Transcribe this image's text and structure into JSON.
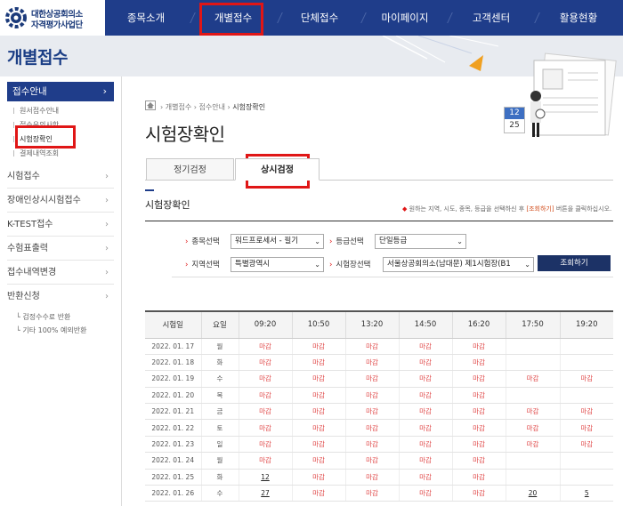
{
  "org": {
    "line1": "대한상공회의소",
    "line2": "자격평가사업단"
  },
  "nav": [
    {
      "label": "종목소개",
      "active": false
    },
    {
      "label": "개별접수",
      "active": true
    },
    {
      "label": "단체접수",
      "active": false
    },
    {
      "label": "마이페이지",
      "active": false
    },
    {
      "label": "고객센터",
      "active": false
    },
    {
      "label": "활용현황",
      "active": false
    }
  ],
  "page_title": "개별접수",
  "sidebar": {
    "head": "접수안내",
    "sub_items": [
      "원서접수안내",
      "접수유의사항",
      "시험장확인",
      "결제내역조회"
    ],
    "items": [
      "시험접수",
      "장애인상시시험접수",
      "K-TEST접수",
      "수험표출력",
      "접수내역변경",
      "반환신청"
    ],
    "refund_sub": [
      "검정수수료 반환",
      "기타 100% 예외반환"
    ]
  },
  "breadcrumb": [
    "개별접수",
    "접수안내",
    "시험장확인"
  ],
  "content_title": "시험장확인",
  "tabs": [
    {
      "label": "정기검정",
      "active": false
    },
    {
      "label": "상시검정",
      "active": true
    }
  ],
  "section": {
    "title": "시험장확인",
    "note_before": "원하는 지역, 시도, 종목, 등급을 선택하신 후 ",
    "note_accent": "[조회하기]",
    "note_after": " 버튼을 클릭하십시오."
  },
  "form": {
    "subject_label": "종목선택",
    "subject_value": "워드프로세서 - 필기",
    "grade_label": "등급선택",
    "grade_value": "단일등급",
    "region_label": "지역선택",
    "region_value": "특별광역시",
    "venue_label": "시험장선택",
    "venue_value": "서울상공회의소(남대문) 제1시험장(B1",
    "search_button": "조회하기"
  },
  "schedule": {
    "headers": [
      "시험일",
      "요일",
      "09:20",
      "10:50",
      "13:20",
      "14:50",
      "16:20",
      "17:50",
      "19:20"
    ],
    "rows": [
      [
        "2022. 01. 17",
        "월",
        "마감",
        "마감",
        "마감",
        "마감",
        "마감",
        "",
        ""
      ],
      [
        "2022. 01. 18",
        "화",
        "마감",
        "마감",
        "마감",
        "마감",
        "마감",
        "",
        ""
      ],
      [
        "2022. 01. 19",
        "수",
        "마감",
        "마감",
        "마감",
        "마감",
        "마감",
        "마감",
        "마감"
      ],
      [
        "2022. 01. 20",
        "목",
        "마감",
        "마감",
        "마감",
        "마감",
        "마감",
        "",
        ""
      ],
      [
        "2022. 01. 21",
        "금",
        "마감",
        "마감",
        "마감",
        "마감",
        "마감",
        "마감",
        "마감"
      ],
      [
        "2022. 01. 22",
        "토",
        "마감",
        "마감",
        "마감",
        "마감",
        "마감",
        "마감",
        "마감"
      ],
      [
        "2022. 01. 23",
        "일",
        "마감",
        "마감",
        "마감",
        "마감",
        "마감",
        "마감",
        "마감"
      ],
      [
        "2022. 01. 24",
        "월",
        "마감",
        "마감",
        "마감",
        "마감",
        "마감",
        "",
        ""
      ],
      [
        "2022. 01. 25",
        "화",
        "12",
        "마감",
        "마감",
        "마감",
        "마감",
        "",
        ""
      ],
      [
        "2022. 01. 26",
        "수",
        "27",
        "마감",
        "마감",
        "마감",
        "마감",
        "20",
        "5"
      ]
    ]
  },
  "calendar_icon": {
    "top": "12",
    "bottom": "25"
  },
  "colors": {
    "nav_bg": "#1f3d8a",
    "highlight": "#e01616",
    "closed": "#e04848",
    "button": "#1c3266"
  }
}
